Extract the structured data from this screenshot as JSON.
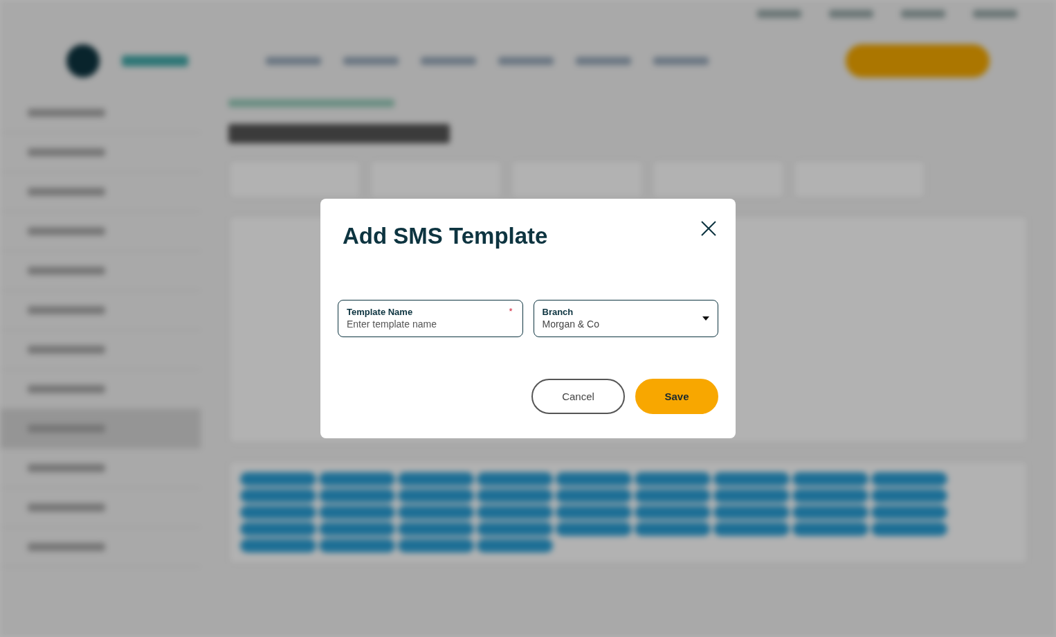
{
  "dialog": {
    "title": "Add SMS Template",
    "fields": [
      {
        "kind": "text",
        "label": "Template Name",
        "placeholder": "Enter template name",
        "required_mark": "*"
      },
      {
        "kind": "select",
        "label": "Branch",
        "value": "Morgan & Co"
      }
    ],
    "buttons": [
      {
        "kind": "secondary",
        "label": "Cancel"
      },
      {
        "kind": "primary",
        "label": "Save"
      }
    ]
  }
}
